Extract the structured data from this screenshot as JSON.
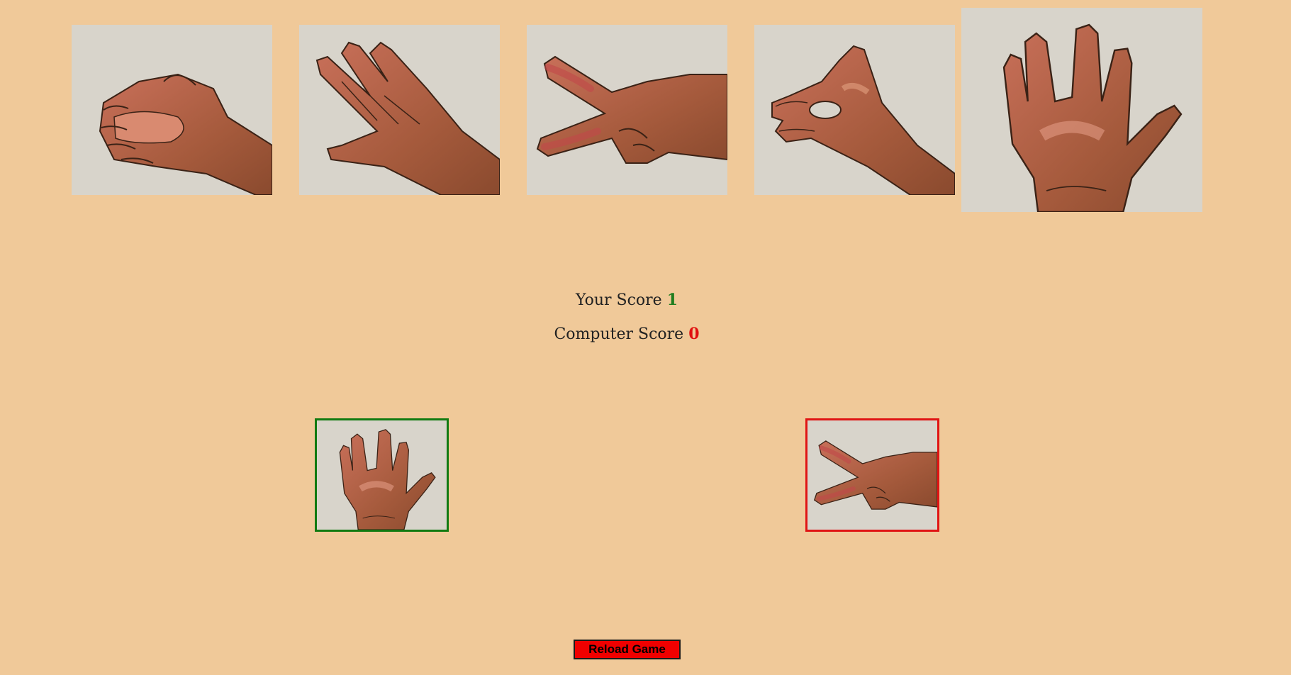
{
  "choices": [
    {
      "id": "rock",
      "icon": "rock-hand-icon"
    },
    {
      "id": "paper",
      "icon": "paper-hand-icon"
    },
    {
      "id": "scissors",
      "icon": "scissors-hand-icon"
    },
    {
      "id": "lizard",
      "icon": "lizard-hand-icon"
    },
    {
      "id": "spock",
      "icon": "spock-hand-icon"
    }
  ],
  "score": {
    "your_label": "Your Score",
    "your_value": "1",
    "computer_label": "Computer Score",
    "computer_value": "0"
  },
  "result": {
    "player_choice": "spock",
    "computer_choice": "scissors"
  },
  "reload_label": "Reload Game",
  "colors": {
    "background": "#f0c999",
    "win": "#117a11",
    "lose": "#e01414",
    "button": "#f00000"
  }
}
